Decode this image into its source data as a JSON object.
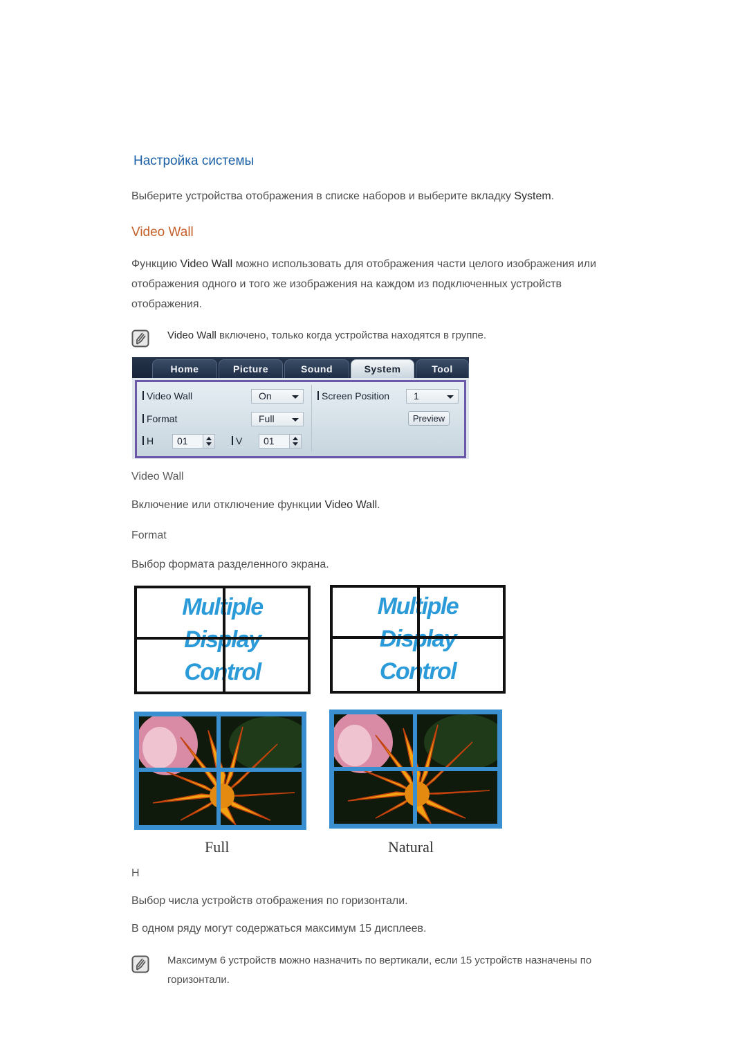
{
  "heading": "Настройка системы",
  "intro": {
    "text": "Выберите устройства отображения в списке наборов и выберите вкладку ",
    "bold": "System",
    "end": "."
  },
  "section_title": "Video Wall",
  "description": {
    "line1_pre": "Функцию ",
    "line1_bold": "Video Wall",
    "line1_post": " можно использовать для отображения части целого изображения или",
    "line2": "отображения одного и того же изображения на каждом из подключенных устройств",
    "line3": "отображения."
  },
  "note1": {
    "icon": "note-pencil-icon",
    "bold": "Video Wall",
    "text": " включено, только когда устройства находятся в группе."
  },
  "panel": {
    "tabs": [
      {
        "label": "Home",
        "active": false
      },
      {
        "label": "Picture",
        "active": false
      },
      {
        "label": "Sound",
        "active": false
      },
      {
        "label": "System",
        "active": true
      },
      {
        "label": "Tool",
        "active": false
      }
    ],
    "video_wall": {
      "label": "Video Wall",
      "value": "On"
    },
    "format": {
      "label": "Format",
      "value": "Full"
    },
    "h": {
      "label": "H",
      "value": "01"
    },
    "v": {
      "label": "V",
      "value": "01"
    },
    "screen_position": {
      "label": "Screen Position",
      "value": "1"
    },
    "preview_label": "Preview"
  },
  "items": {
    "video_wall": {
      "title": "Video Wall",
      "text": "Включение или отключение функции ",
      "bold": "Video Wall",
      "end": "."
    },
    "format": {
      "title": "Format",
      "text": "Выбор формата разделенного экрана."
    },
    "h": {
      "title": "H",
      "text1": "Выбор числа устройств отображения по горизонтали.",
      "text2": "В одном ряду могут содержаться максимум 15 дисплеев."
    }
  },
  "illustration": {
    "words": [
      "Multiple",
      "Display",
      "Control"
    ],
    "captions": {
      "full": "Full",
      "natural": "Natural"
    },
    "text_color": "#2a9ad8",
    "frame_color": "#3a8fd0"
  },
  "note2": {
    "icon": "note-pencil-icon",
    "line1": "Максимум 6 устройств можно назначить по вертикали, если 15 устройств назначены по",
    "line2": "горизонтали."
  }
}
